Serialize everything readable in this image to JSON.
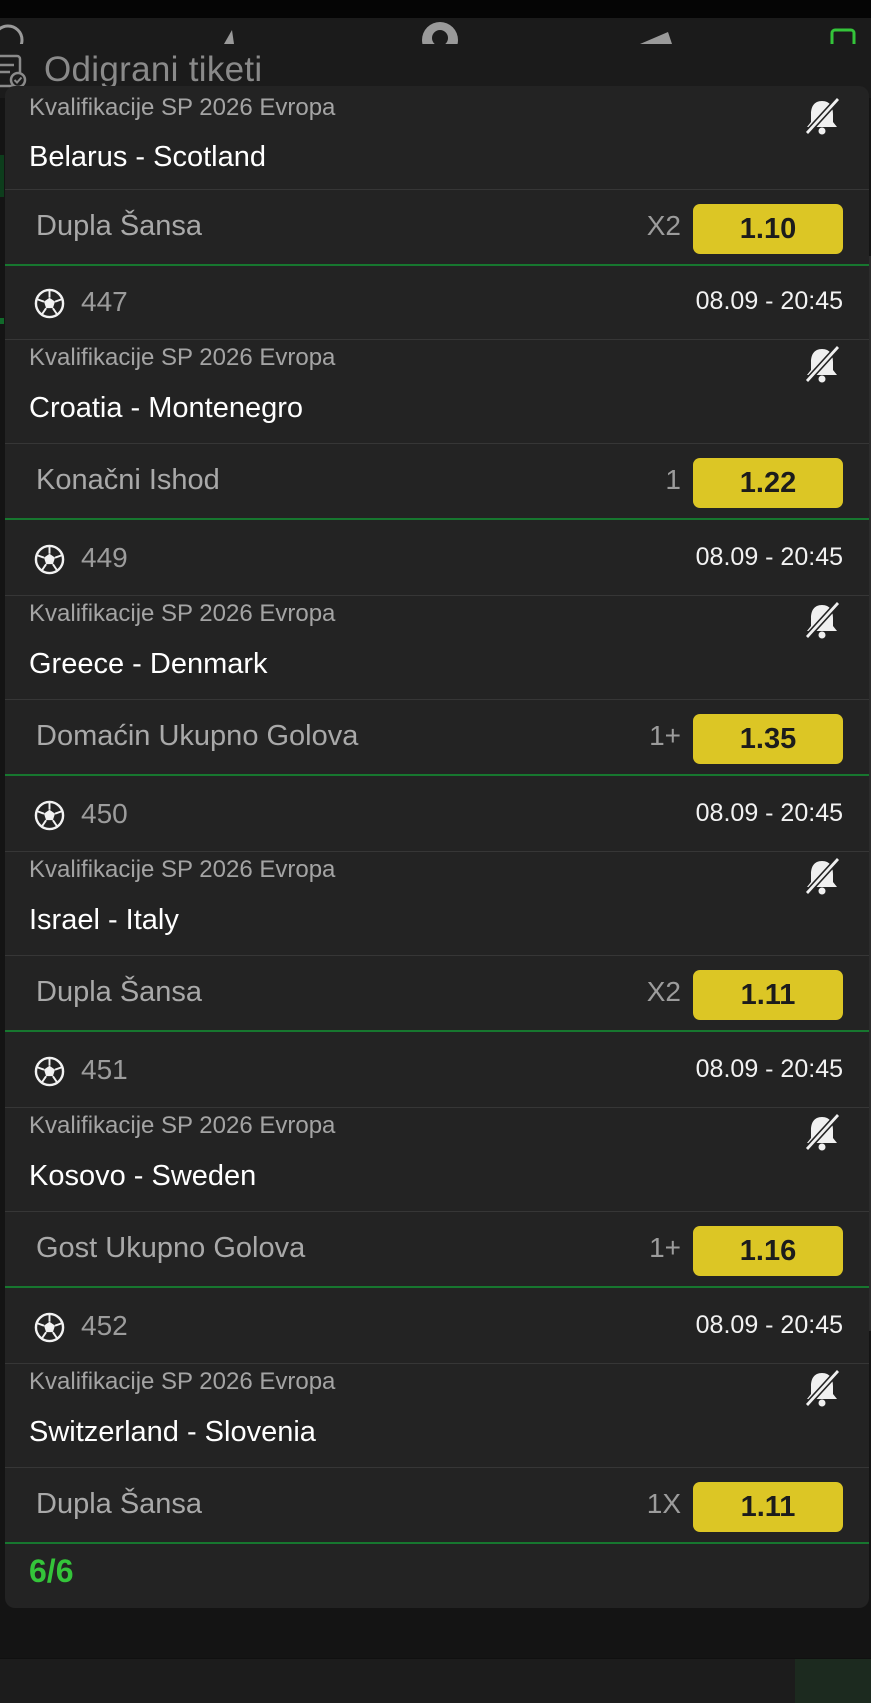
{
  "page": {
    "title": "Odigrani tiketi"
  },
  "ticket": {
    "counter": "6/6",
    "items": [
      {
        "code": "",
        "date_time": "",
        "league": "Kvalifikacije SP 2026 Evropa",
        "teams": "Belarus - Scotland",
        "market": "Dupla Šansa",
        "pick": "X2",
        "odd": "1.10"
      },
      {
        "code": "447",
        "date_time": "08.09  -  20:45",
        "league": "Kvalifikacije SP 2026 Evropa",
        "teams": "Croatia - Montenegro",
        "market": "Konačni Ishod",
        "pick": "1",
        "odd": "1.22"
      },
      {
        "code": "449",
        "date_time": "08.09  -  20:45",
        "league": "Kvalifikacije SP 2026 Evropa",
        "teams": "Greece - Denmark",
        "market": "Domaćin Ukupno Golova",
        "pick": "1+",
        "odd": "1.35"
      },
      {
        "code": "450",
        "date_time": "08.09  -  20:45",
        "league": "Kvalifikacije SP 2026 Evropa",
        "teams": "Israel - Italy",
        "market": "Dupla Šansa",
        "pick": "X2",
        "odd": "1.11"
      },
      {
        "code": "451",
        "date_time": "08.09  -  20:45",
        "league": "Kvalifikacije SP 2026 Evropa",
        "teams": "Kosovo - Sweden",
        "market": "Gost Ukupno Golova",
        "pick": "1+",
        "odd": "1.16"
      },
      {
        "code": "452",
        "date_time": "08.09  -  20:45",
        "league": "Kvalifikacije SP 2026 Evropa",
        "teams": "Switzerland - Slovenia",
        "market": "Dupla Šansa",
        "pick": "1X",
        "odd": "1.11"
      }
    ]
  },
  "colors": {
    "odd_button": "#dcc625",
    "divider_green": "#17772f",
    "counter_green": "#34c43a",
    "modal_bg": "#232323"
  },
  "icons": {
    "sport": "soccer-ball-icon",
    "notification": "bell-off-icon",
    "page_title": "ticket-list-icon"
  }
}
